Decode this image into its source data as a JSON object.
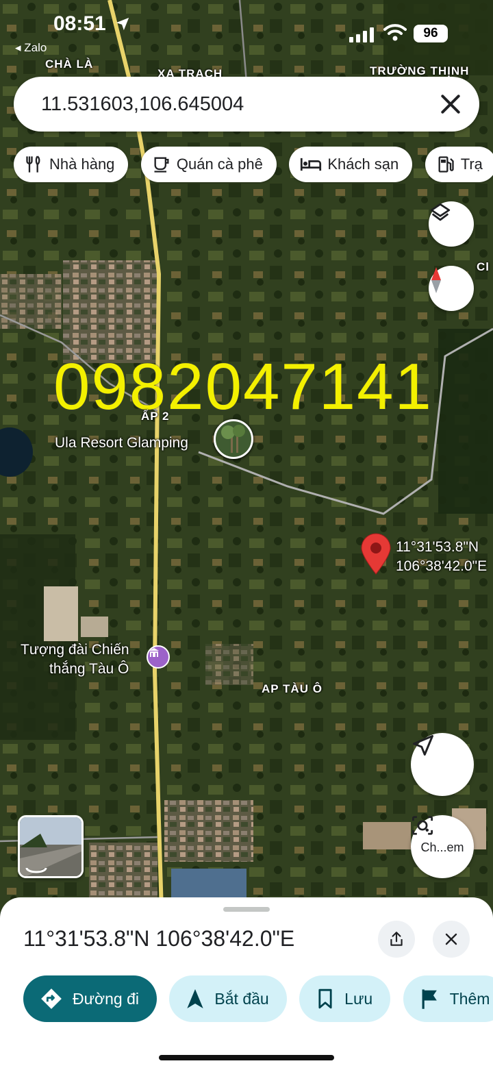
{
  "status_bar": {
    "time": "08:51",
    "back_app": "Zalo",
    "battery": "96"
  },
  "search": {
    "value": "11.531603,106.645004"
  },
  "chips": [
    {
      "label": "Nhà hàng",
      "icon": "restaurant-icon"
    },
    {
      "label": "Quán cà phê",
      "icon": "coffee-icon"
    },
    {
      "label": "Khách sạn",
      "icon": "hotel-icon"
    },
    {
      "label": "Trạ",
      "icon": "gas-station-icon"
    }
  ],
  "map": {
    "labels": {
      "cha_la": "CHÀ LÀ",
      "xa_trach": "XA TRẠCH",
      "truong_thinh": "TRƯỜNG THỊNH",
      "ap2": "ẤP 2",
      "ap_tau_o": "AP TÀU Ô",
      "edge_ch": "Cl"
    },
    "places": {
      "ula_resort": "Ula Resort Glamping",
      "monument_line1": "Tượng đài Chiến",
      "monument_line2": "thắng Tàu Ô"
    },
    "pin": {
      "lat": "11°31'53.8\"N",
      "lng": "106°38'42.0\"E"
    },
    "overlay_phone": "0982047141",
    "lens_label": "Ch...em"
  },
  "sheet": {
    "title": "11°31'53.8\"N 106°38'42.0\"E",
    "actions": [
      {
        "label": "Đường đi",
        "icon": "directions-icon",
        "style": "primary"
      },
      {
        "label": "Bắt đầu",
        "icon": "navigation-arrow-icon",
        "style": "secondary"
      },
      {
        "label": "Lưu",
        "icon": "bookmark-icon",
        "style": "secondary"
      },
      {
        "label": "Thêm",
        "icon": "flag-icon",
        "style": "secondary"
      }
    ]
  },
  "colors": {
    "primary_action": "#0b6a76",
    "secondary_action": "#d3f1f8",
    "pin_red": "#e53935",
    "phone_overlay": "#f3f000",
    "road_yellow": "#e8d36a"
  }
}
